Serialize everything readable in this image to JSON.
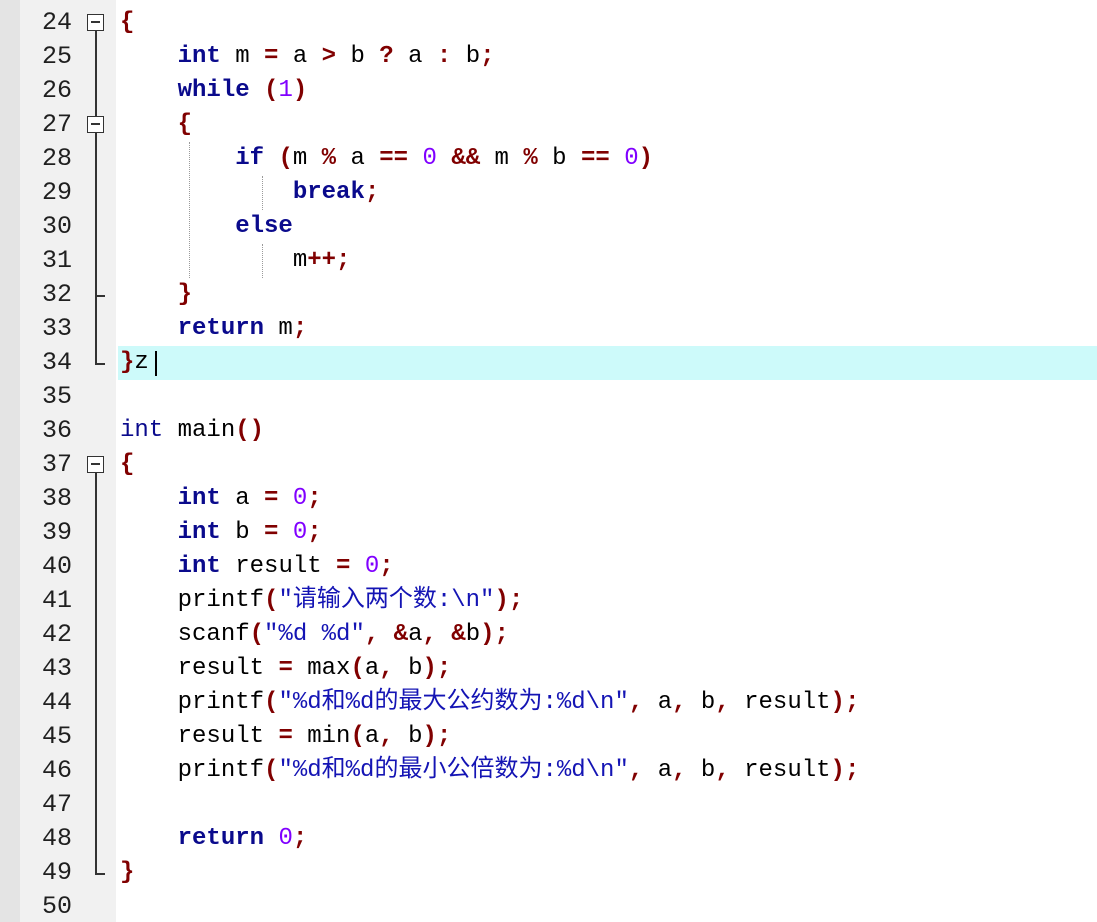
{
  "editor": {
    "current_line": 34,
    "lines": [
      {
        "n": "24",
        "tokens": [
          [
            "{",
            "br"
          ]
        ]
      },
      {
        "n": "25",
        "tokens": [
          [
            "    ",
            ""
          ],
          [
            "int",
            "kw"
          ],
          [
            " m ",
            ""
          ],
          [
            "=",
            "op"
          ],
          [
            " a ",
            ""
          ],
          [
            ">",
            "op"
          ],
          [
            " b ",
            ""
          ],
          [
            "?",
            "op"
          ],
          [
            " a ",
            ""
          ],
          [
            ":",
            "op"
          ],
          [
            " b",
            ""
          ],
          [
            ";",
            "op"
          ]
        ]
      },
      {
        "n": "26",
        "tokens": [
          [
            "    ",
            ""
          ],
          [
            "while",
            "kw"
          ],
          [
            " ",
            ""
          ],
          [
            "(",
            "op"
          ],
          [
            "1",
            "num"
          ],
          [
            ")",
            "op"
          ]
        ]
      },
      {
        "n": "27",
        "tokens": [
          [
            "    ",
            ""
          ],
          [
            "{",
            "br"
          ]
        ]
      },
      {
        "n": "28",
        "tokens": [
          [
            "        ",
            ""
          ],
          [
            "if",
            "kw"
          ],
          [
            " ",
            ""
          ],
          [
            "(",
            "op"
          ],
          [
            "m ",
            ""
          ],
          [
            "%",
            "op"
          ],
          [
            " a ",
            ""
          ],
          [
            "==",
            "op"
          ],
          [
            " ",
            ""
          ],
          [
            "0",
            "num"
          ],
          [
            " ",
            ""
          ],
          [
            "&&",
            "op"
          ],
          [
            " m ",
            ""
          ],
          [
            "%",
            "op"
          ],
          [
            " b ",
            ""
          ],
          [
            "==",
            "op"
          ],
          [
            " ",
            ""
          ],
          [
            "0",
            "num"
          ],
          [
            ")",
            "op"
          ]
        ]
      },
      {
        "n": "29",
        "tokens": [
          [
            "            ",
            ""
          ],
          [
            "break",
            "kw"
          ],
          [
            ";",
            "op"
          ]
        ]
      },
      {
        "n": "30",
        "tokens": [
          [
            "        ",
            ""
          ],
          [
            "else",
            "kw"
          ]
        ]
      },
      {
        "n": "31",
        "tokens": [
          [
            "            ",
            ""
          ],
          [
            "m",
            ""
          ],
          [
            "++",
            "op"
          ],
          [
            ";",
            "op"
          ]
        ]
      },
      {
        "n": "32",
        "tokens": [
          [
            "    ",
            ""
          ],
          [
            "}",
            "br"
          ]
        ]
      },
      {
        "n": "33",
        "tokens": [
          [
            "    ",
            ""
          ],
          [
            "return",
            "kw"
          ],
          [
            " m",
            ""
          ],
          [
            ";",
            "op"
          ]
        ]
      },
      {
        "n": "34",
        "tokens": [
          [
            "}",
            "br"
          ],
          [
            "z",
            ""
          ]
        ]
      },
      {
        "n": "35",
        "tokens": []
      },
      {
        "n": "36",
        "tokens": [
          [
            "int",
            "ty"
          ],
          [
            " main",
            ""
          ],
          [
            "()",
            "op"
          ]
        ]
      },
      {
        "n": "37",
        "tokens": [
          [
            "{",
            "br"
          ]
        ]
      },
      {
        "n": "38",
        "tokens": [
          [
            "    ",
            ""
          ],
          [
            "int",
            "kw"
          ],
          [
            " a ",
            ""
          ],
          [
            "=",
            "op"
          ],
          [
            " ",
            ""
          ],
          [
            "0",
            "num"
          ],
          [
            ";",
            "op"
          ]
        ]
      },
      {
        "n": "39",
        "tokens": [
          [
            "    ",
            ""
          ],
          [
            "int",
            "kw"
          ],
          [
            " b ",
            ""
          ],
          [
            "=",
            "op"
          ],
          [
            " ",
            ""
          ],
          [
            "0",
            "num"
          ],
          [
            ";",
            "op"
          ]
        ]
      },
      {
        "n": "40",
        "tokens": [
          [
            "    ",
            ""
          ],
          [
            "int",
            "kw"
          ],
          [
            " result ",
            ""
          ],
          [
            "=",
            "op"
          ],
          [
            " ",
            ""
          ],
          [
            "0",
            "num"
          ],
          [
            ";",
            "op"
          ]
        ]
      },
      {
        "n": "41",
        "tokens": [
          [
            "    ",
            ""
          ],
          [
            "printf",
            ""
          ],
          [
            "(",
            "op"
          ],
          [
            "\"请输入两个数:\\n\"",
            "str"
          ],
          [
            ")",
            "op"
          ],
          [
            ";",
            "op"
          ]
        ]
      },
      {
        "n": "42",
        "tokens": [
          [
            "    ",
            ""
          ],
          [
            "scanf",
            ""
          ],
          [
            "(",
            "op"
          ],
          [
            "\"%d %d\"",
            "str"
          ],
          [
            ", ",
            "op"
          ],
          [
            "&",
            "op"
          ],
          [
            "a",
            ""
          ],
          [
            ", ",
            "op"
          ],
          [
            "&",
            "op"
          ],
          [
            "b",
            ""
          ],
          [
            ")",
            "op"
          ],
          [
            ";",
            "op"
          ]
        ]
      },
      {
        "n": "43",
        "tokens": [
          [
            "    ",
            ""
          ],
          [
            "result ",
            ""
          ],
          [
            "=",
            "op"
          ],
          [
            " max",
            ""
          ],
          [
            "(",
            "op"
          ],
          [
            "a",
            ""
          ],
          [
            ", ",
            "op"
          ],
          [
            "b",
            ""
          ],
          [
            ")",
            "op"
          ],
          [
            ";",
            "op"
          ]
        ]
      },
      {
        "n": "44",
        "tokens": [
          [
            "    ",
            ""
          ],
          [
            "printf",
            ""
          ],
          [
            "(",
            "op"
          ],
          [
            "\"%d和%d的最大公约数为:%d\\n\"",
            "str"
          ],
          [
            ", ",
            "op"
          ],
          [
            "a",
            ""
          ],
          [
            ", ",
            "op"
          ],
          [
            "b",
            ""
          ],
          [
            ", ",
            "op"
          ],
          [
            "result",
            ""
          ],
          [
            ")",
            "op"
          ],
          [
            ";",
            "op"
          ]
        ]
      },
      {
        "n": "45",
        "tokens": [
          [
            "    ",
            ""
          ],
          [
            "result ",
            ""
          ],
          [
            "=",
            "op"
          ],
          [
            " min",
            ""
          ],
          [
            "(",
            "op"
          ],
          [
            "a",
            ""
          ],
          [
            ", ",
            "op"
          ],
          [
            "b",
            ""
          ],
          [
            ")",
            "op"
          ],
          [
            ";",
            "op"
          ]
        ]
      },
      {
        "n": "46",
        "tokens": [
          [
            "    ",
            ""
          ],
          [
            "printf",
            ""
          ],
          [
            "(",
            "op"
          ],
          [
            "\"%d和%d的最小公倍数为:%d\\n\"",
            "str"
          ],
          [
            ", ",
            "op"
          ],
          [
            "a",
            ""
          ],
          [
            ", ",
            "op"
          ],
          [
            "b",
            ""
          ],
          [
            ", ",
            "op"
          ],
          [
            "result",
            ""
          ],
          [
            ")",
            "op"
          ],
          [
            ";",
            "op"
          ]
        ]
      },
      {
        "n": "47",
        "tokens": []
      },
      {
        "n": "48",
        "tokens": [
          [
            "    ",
            ""
          ],
          [
            "return",
            "kw"
          ],
          [
            " ",
            ""
          ],
          [
            "0",
            "num"
          ],
          [
            ";",
            "op"
          ]
        ]
      },
      {
        "n": "49",
        "tokens": [
          [
            "}",
            "br"
          ]
        ]
      },
      {
        "n": "50",
        "tokens": []
      }
    ],
    "fold_markers": [
      {
        "line": "24",
        "kind": "collapse-box-icon"
      },
      {
        "line": "27",
        "kind": "collapse-box-icon"
      },
      {
        "line": "32",
        "kind": "fold-end"
      },
      {
        "line": "34",
        "kind": "fold-end"
      },
      {
        "line": "37",
        "kind": "collapse-box-icon"
      },
      {
        "line": "49",
        "kind": "fold-end"
      }
    ],
    "colors": {
      "keyword": "#0a0a8c",
      "operator": "#800000",
      "number": "#8000ff",
      "string": "#1414b4",
      "current_line_bg": "#cdfafa",
      "gutter_bg": "#f1f1f1"
    }
  }
}
